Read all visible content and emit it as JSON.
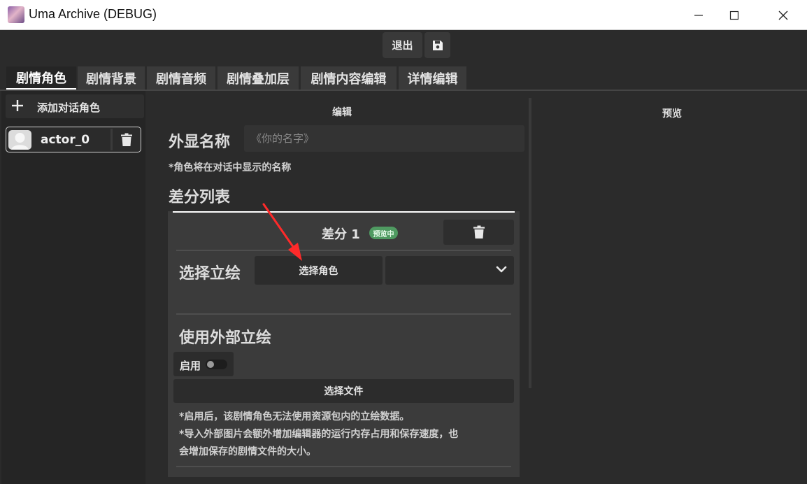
{
  "window": {
    "title": "Uma Archive (DEBUG)",
    "controls": [
      "minimize-icon",
      "maximize-icon",
      "close-icon"
    ]
  },
  "toolbar": {
    "exit_label": "退出",
    "save_icon": "save-icon"
  },
  "tabs": [
    {
      "label": "剧情角色",
      "active": true
    },
    {
      "label": "剧情背景",
      "active": false
    },
    {
      "label": "剧情音频",
      "active": false
    },
    {
      "label": "剧情叠加层",
      "active": false
    },
    {
      "label": "剧情内容编辑",
      "active": false
    },
    {
      "label": "详情编辑",
      "active": false
    }
  ],
  "sidebar": {
    "add_label": "添加对话角色",
    "actors": [
      {
        "name": "actor_0",
        "avatar_icon": "avatar-placeholder-icon",
        "delete_icon": "trash-icon"
      }
    ]
  },
  "editor": {
    "panel_title": "编辑",
    "display_name_label": "外显名称",
    "display_name_value": "",
    "display_name_placeholder": "《你的名字》",
    "display_name_hint": "*角色将在对话中显示的名称",
    "variant_list_label": "差分列表",
    "variants": [
      {
        "title": "差分 1",
        "badge": "预览中",
        "select_portrait_label": "选择立绘",
        "choose_character_label": "选择角色",
        "dropdown_value": "",
        "external_portrait_label": "使用外部立绘",
        "enable_label": "启用",
        "enabled": false,
        "choose_file_label": "选择文件",
        "notes": [
          "*启用后，该剧情角色无法使用资源包内的立绘数据。",
          "*导入外部图片会额外增加编辑器的运行内存占用和保存速度，也",
          "会增加保存的剧情文件的大小。"
        ]
      }
    ]
  },
  "preview": {
    "panel_title": "预览"
  },
  "colors": {
    "background": "#2b2b2b",
    "panel": "#3b3b3b",
    "badge": "#4f9a61",
    "annotation_arrow": "#ff2a2a"
  }
}
